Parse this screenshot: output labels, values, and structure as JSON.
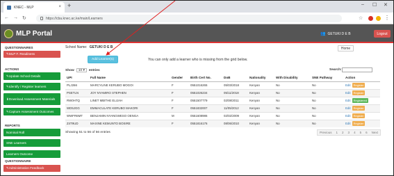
{
  "browser": {
    "tab_title": "KNEC - MLP",
    "url": "https://cba.knec.ac.ke/main/Learners",
    "new_tab": "+",
    "tab_close": "×",
    "window_controls": [
      "–",
      "☐",
      "✕"
    ]
  },
  "app": {
    "title": "MLP Portal",
    "user": "GETUKI D E B",
    "logout_label": "Logout",
    "brand_colors": {
      "header": "#555555",
      "green": "#169c3a",
      "red": "#d9534f",
      "info": "#5bc0de"
    }
  },
  "sidebar": {
    "sections": {
      "questionnaires": "QUESTIONNAIRES",
      "actions": "ACTIONS",
      "reports": "REPORTS",
      "questionnaire": "QUESTIONNAIRE"
    },
    "items": [
      {
        "label": "MLP F. Readiness"
      },
      {
        "label": "Update School Details"
      },
      {
        "label": "Identify / Register learners"
      },
      {
        "label": "Download Assessment Materials"
      },
      {
        "label": "Capture Assessment Outcomes"
      },
      {
        "label": "Nominal Roll"
      },
      {
        "label": "SNE Learners"
      },
      {
        "label": "Learners Outcome"
      },
      {
        "label": "Administration Feedback"
      }
    ]
  },
  "main": {
    "school_label": "School Name:",
    "school_name": "GETUKI D E B",
    "home_label": "Home",
    "add_button": "Add Learner(s)",
    "note": "You can only add a learner who is missing from the grid below.",
    "show_prefix": "Show",
    "show_value": "10",
    "show_suffix": "entries",
    "search_label": "Search:",
    "table": {
      "headers": [
        "UPI",
        "Full Name",
        "Gender",
        "Birth Cert No.",
        "DoB",
        "Nationality",
        "With Disability",
        "SNE Pathway",
        "Action"
      ],
      "rows": [
        {
          "upi": "PLJ266",
          "name": "MARCYLINE KERUBO MOGOI",
          "gender": "F",
          "cert": "0551016265",
          "dob": "05/03/2018",
          "nat": "Kenyan",
          "dis": "No",
          "sne": "No",
          "edit": "Edit",
          "badge": "Register",
          "badge_color": "orange"
        },
        {
          "upi": "PSETLN",
          "name": "JOY NYAMIRO STEPHEN",
          "gender": "F",
          "cert": "0551026234",
          "dob": "05/11/2018",
          "nat": "Kenyan",
          "dis": "No",
          "sne": "No",
          "edit": "Edit",
          "badge": "Register",
          "badge_color": "orange"
        },
        {
          "upi": "RW0HTQ",
          "name": "LINET MBITHE ELIJAH",
          "gender": "F",
          "cert": "0551507779",
          "dob": "02/08/2011",
          "nat": "Kenyan",
          "dis": "No",
          "sne": "No",
          "edit": "Edit",
          "badge": "Registered",
          "badge_color": "green"
        },
        {
          "upi": "WD5JGG",
          "name": "EMMACULATE KERUBO MAKORI",
          "gender": "F",
          "cert": "0551832007",
          "dob": "11/05/2012",
          "nat": "Kenyan",
          "dis": "No",
          "sne": "No",
          "edit": "Edit",
          "badge": "Register",
          "badge_color": "orange"
        },
        {
          "upi": "WWFR6MT",
          "name": "BENJAMIN NYANGWESO OENGA",
          "gender": "M",
          "cert": "0551608986",
          "dob": "02/02/2009",
          "nat": "Kenyan",
          "dis": "No",
          "sne": "No",
          "edit": "Edit",
          "badge": "Register",
          "badge_color": "orange"
        },
        {
          "upi": "Z4T9UD",
          "name": "MAXINE KEMUNTO BOSIRE",
          "gender": "F",
          "cert": "0551816176",
          "dob": "08/06/2010",
          "nat": "Kenyan",
          "dis": "No",
          "sne": "No",
          "edit": "Edit",
          "badge": "Register",
          "badge_color": "orange"
        }
      ]
    },
    "info": "Showing 51 to 56 of 56 entries",
    "pager": [
      "Previous",
      "1",
      "2",
      "3",
      "4",
      "5",
      "6",
      "Next"
    ]
  }
}
